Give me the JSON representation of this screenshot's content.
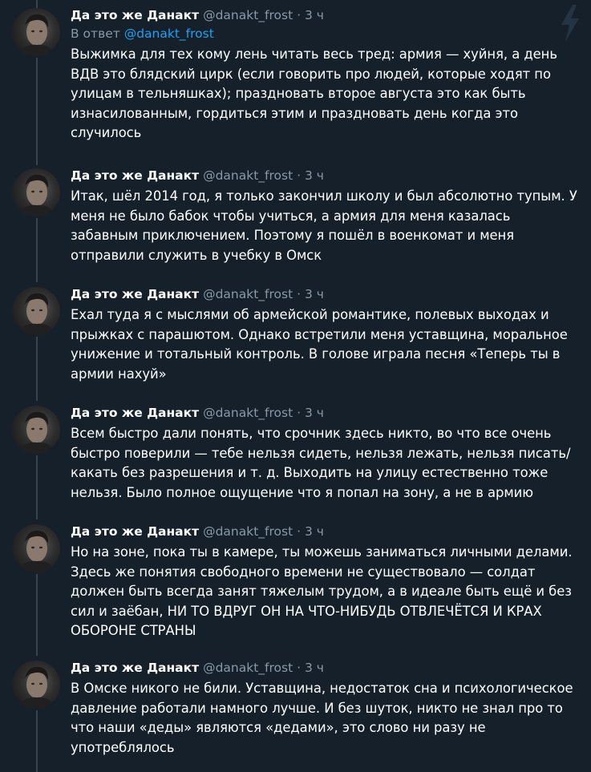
{
  "colors": {
    "background": "#15202b",
    "text": "#ffffff",
    "muted": "#8899a6",
    "link": "#1da1f2",
    "thread_line": "#38444d"
  },
  "icons": {
    "corner": "lightning-bolt-icon",
    "avatar": "user-avatar-photo"
  },
  "tweets": [
    {
      "name": "Да это же Данакт",
      "handle": "@danakt_frost",
      "dot": "·",
      "time": "3 ч",
      "reply_prefix": "В ответ ",
      "reply_handle": "@danakt_frost",
      "text": "Выжимка для тех кому лень читать весь тред: армия — хуйня, а день ВДВ это блядский цирк (если говорить про людей, которые ходят по улицам в тельняшках); праздновать второе августа это как быть изнасилованным, гордиться этим и праздновать день когда это случилось"
    },
    {
      "name": "Да это же Данакт",
      "handle": "@danakt_frost",
      "dot": "·",
      "time": "3 ч",
      "text": "Итак, шёл 2014 год, я только закончил школу и был абсолютно тупым. У меня не было бабок чтобы учиться, а армия для меня казалась забавным приключением. Поэтому я пошёл в военкомат и меня отправили служить в учебку в Омск"
    },
    {
      "name": "Да это же Данакт",
      "handle": "@danakt_frost",
      "dot": "·",
      "time": "3 ч",
      "text": "Ехал туда я с мыслями об армейской романтике, полевых выходах и прыжках с парашютом. Однако встретили меня уставщина, моральное унижение и тотальный контроль. В голове играла песня «Теперь ты в армии нахуй»"
    },
    {
      "name": "Да это же Данакт",
      "handle": "@danakt_frost",
      "dot": "·",
      "time": "3 ч",
      "text": "Всем быстро дали понять, что срочник здесь никто, во что все очень быстро поверили — тебе нельзя сидеть, нельзя лежать, нельзя писать/какать без разрешения и т. д. Выходить на улицу естественно тоже нельзя. Было полное ощущение что я попал на зону, а не в армию"
    },
    {
      "name": "Да это же Данакт",
      "handle": "@danakt_frost",
      "dot": "·",
      "time": "3 ч",
      "text": "Но на зоне, пока ты в камере, ты можешь заниматься личными делами. Здесь же понятия свободного времени не существовало — солдат должен быть всегда занят тяжелым трудом, а в идеале быть ещё и без сил и заёбан, НИ ТО ВДРУГ ОН НА ЧТО-НИБУДЬ ОТВЛЕЧЁТСЯ И КРАХ ОБОРОНЕ СТРАНЫ"
    },
    {
      "name": "Да это же Данакт",
      "handle": "@danakt_frost",
      "dot": "·",
      "time": "3 ч",
      "text": "В Омске никого не били. Уставщина, недостаток сна и психологическое давление работали намного лучше. И без шуток, никто не знал про то что наши «деды» являются «дедами», это слово ни разу не употреблялось"
    }
  ]
}
